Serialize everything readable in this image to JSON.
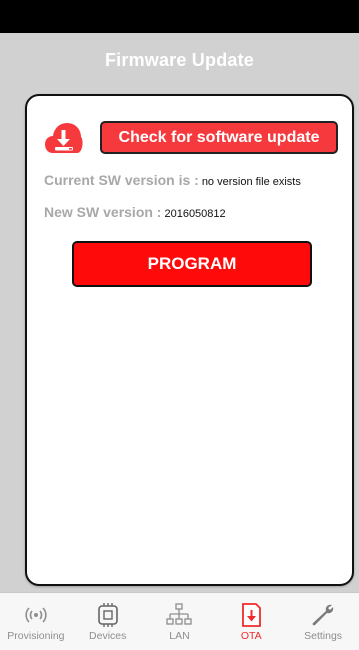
{
  "header": {
    "title": "Firmware Update"
  },
  "update_card": {
    "check_button_label": "Check for software update",
    "current_label": "Current SW version is :",
    "current_value": "no version file exists",
    "new_label": "New SW version :",
    "new_value": "2016050812",
    "program_button_label": "PROGRAM"
  },
  "tabs": [
    {
      "label": "Provisioning",
      "icon": "wireless-signal-icon",
      "active": false
    },
    {
      "label": "Devices",
      "icon": "chip-icon",
      "active": false
    },
    {
      "label": "LAN",
      "icon": "network-tree-icon",
      "active": false
    },
    {
      "label": "OTA",
      "icon": "download-box-icon",
      "active": true
    },
    {
      "label": "Settings",
      "icon": "wrench-icon",
      "active": false
    }
  ],
  "colors": {
    "accent_red": "#f6393d",
    "program_red": "#ff0a0a",
    "nav_gray": "#d1d1d1",
    "label_gray": "#a8a8a8"
  }
}
